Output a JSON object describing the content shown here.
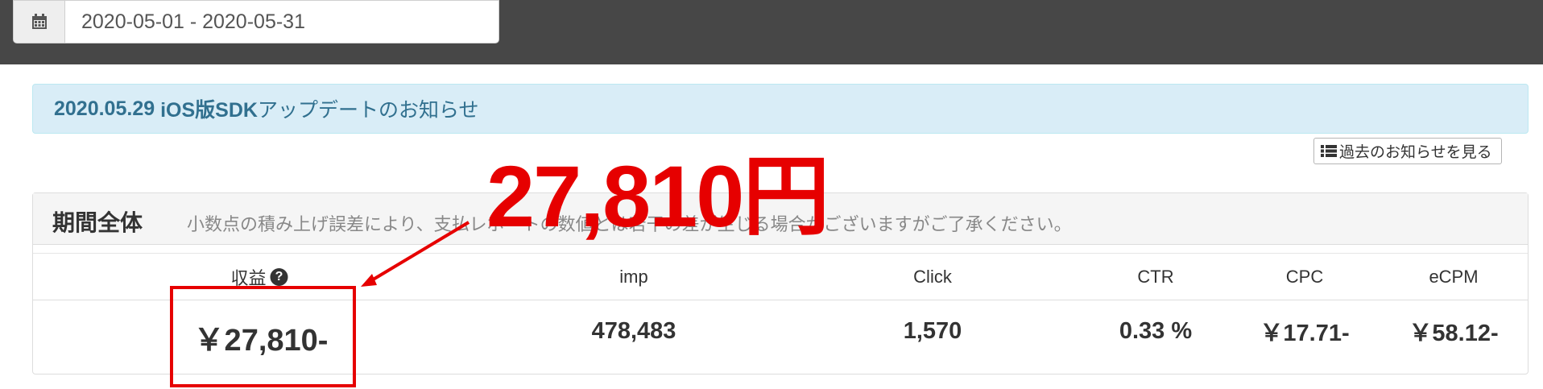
{
  "date_range": {
    "value": "2020-05-01 - 2020-05-31",
    "icon": "calendar-icon"
  },
  "notice": {
    "date": "2020.05.29",
    "text_bold": "iOS版SDK",
    "text_rest": "アップデートのお知らせ"
  },
  "past_notices_button": {
    "label": "過去のお知らせを見る",
    "icon": "list-icon"
  },
  "panel": {
    "title": "期間全体",
    "note": "小数点の積み上げ誤差により、支払レポートの数値とは若干の差が生じる場合がございますがご了承ください。",
    "columns": [
      {
        "label": "収益",
        "has_help": true
      },
      {
        "label": "imp"
      },
      {
        "label": "Click"
      },
      {
        "label": "CTR"
      },
      {
        "label": "CPC"
      },
      {
        "label": "eCPM"
      }
    ],
    "values": [
      "￥27,810-",
      "478,483",
      "1,570",
      "0.33 %",
      "￥17.71-",
      "￥58.12-"
    ]
  },
  "annotation": {
    "text": "27,810円",
    "color": "#e60000"
  }
}
